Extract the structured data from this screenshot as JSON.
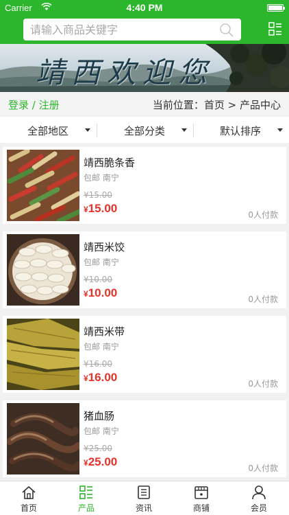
{
  "status": {
    "carrier": "Carrier",
    "time": "4:40 PM"
  },
  "search": {
    "placeholder": "请输入商品关键字"
  },
  "banner": {
    "text": "靖西欢迎您"
  },
  "crumbs": {
    "login": "登录",
    "sep": " / ",
    "register": "注册",
    "location": "当前位置：首页 > 产品中心"
  },
  "filters": [
    {
      "label": "全部地区"
    },
    {
      "label": "全部分类"
    },
    {
      "label": "默认排序"
    }
  ],
  "products": [
    {
      "name": "靖西脆条香",
      "shipping": "包邮 南宁",
      "old_price": "¥15.00",
      "currency": "¥",
      "price": "15.00",
      "sold": "0人付款",
      "image": "crispy-snack-photo"
    },
    {
      "name": "靖西米饺",
      "shipping": "包邮 南宁",
      "old_price": "¥10.00",
      "currency": "¥",
      "price": "10.00",
      "sold": "0人付款",
      "image": "rice-dumpling-photo"
    },
    {
      "name": "靖西米带",
      "shipping": "包邮 南宁",
      "old_price": "¥16.00",
      "currency": "¥",
      "price": "16.00",
      "sold": "0人付款",
      "image": "rice-wrap-photo"
    },
    {
      "name": "猪血肠",
      "shipping": "包邮 南宁",
      "old_price": "¥25.00",
      "currency": "¥",
      "price": "25.00",
      "sold": "0人付款",
      "image": "blood-sausage-photo"
    }
  ],
  "tabs": [
    {
      "label": "首页",
      "icon": "home-icon"
    },
    {
      "label": "产品",
      "icon": "list-icon",
      "active": true
    },
    {
      "label": "资讯",
      "icon": "news-icon"
    },
    {
      "label": "商铺",
      "icon": "store-icon"
    },
    {
      "label": "会员",
      "icon": "user-icon"
    }
  ],
  "colors": {
    "brand": "#2bb62b",
    "price": "#e5332a"
  }
}
